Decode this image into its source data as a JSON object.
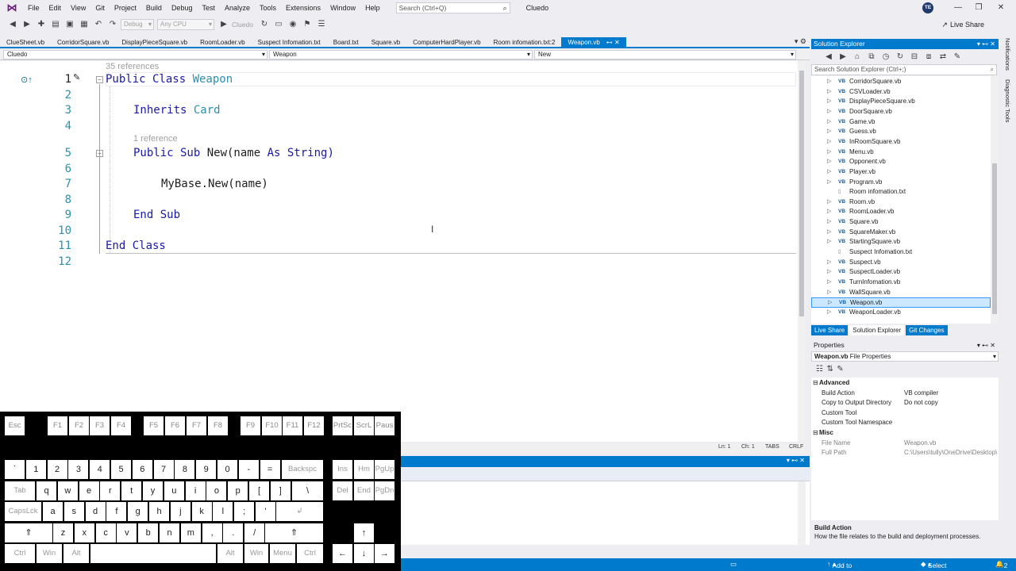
{
  "menu": {
    "items": [
      "File",
      "Edit",
      "View",
      "Git",
      "Project",
      "Build",
      "Debug",
      "Test",
      "Analyze",
      "Tools",
      "Extensions",
      "Window",
      "Help"
    ],
    "search_placeholder": "Search (Ctrl+Q)",
    "solution_name": "Cluedo",
    "avatar_initials": "TE"
  },
  "toolbar": {
    "config": "Debug",
    "platform": "Any CPU",
    "start_target": "Cluedo",
    "live_share": "Live Share"
  },
  "tabs": [
    {
      "label": "ClueSheet.vb",
      "active": false
    },
    {
      "label": "CorridorSquare.vb",
      "active": false
    },
    {
      "label": "DisplayPieceSquare.vb",
      "active": false
    },
    {
      "label": "RoomLoader.vb",
      "active": false
    },
    {
      "label": "Suspect Infomation.txt",
      "active": false
    },
    {
      "label": "Board.txt",
      "active": false
    },
    {
      "label": "Square.vb",
      "active": false
    },
    {
      "label": "ComputerHardPlayer.vb",
      "active": false
    },
    {
      "label": "Room infomation.txt:2",
      "active": false
    },
    {
      "label": "Weapon.vb",
      "active": true
    }
  ],
  "navbar": {
    "project": "Cluedo",
    "class": "Weapon",
    "member": "New"
  },
  "editor": {
    "codelens_class": "35 references",
    "codelens_sub": "1 reference",
    "lines": {
      "1": {
        "kw": "Public Class ",
        "ty": "Weapon"
      },
      "3": {
        "kw": "Inherits ",
        "ty": "Card"
      },
      "5": {
        "kw": "Public Sub ",
        "rest": "New(name ",
        "kw2": "As ",
        "rest2": "String)"
      },
      "7": {
        "text": "MyBase.New(name)"
      },
      "9": {
        "kw": "End Sub"
      },
      "11": {
        "kw": "End Class"
      }
    },
    "line_numbers": [
      "1",
      "2",
      "3",
      "4",
      "5",
      "6",
      "7",
      "8",
      "9",
      "10",
      "11",
      "12"
    ],
    "status": {
      "line": "Ln: 1",
      "col": "Ch: 1",
      "tabs": "TABS",
      "eol": "CRLF"
    }
  },
  "solution_explorer": {
    "title": "Solution Explorer",
    "search_placeholder": "Search Solution Explorer (Ctrl+;)",
    "items": [
      {
        "label": "CorridorSquare.vb",
        "type": "vb"
      },
      {
        "label": "CSVLoader.vb",
        "type": "vb"
      },
      {
        "label": "DisplayPieceSquare.vb",
        "type": "vb"
      },
      {
        "label": "DoorSquare.vb",
        "type": "vb"
      },
      {
        "label": "Game.vb",
        "type": "vb"
      },
      {
        "label": "Guess.vb",
        "type": "vb"
      },
      {
        "label": "InRoomSquare.vb",
        "type": "vb"
      },
      {
        "label": "Menu.vb",
        "type": "vb"
      },
      {
        "label": "Opponent.vb",
        "type": "vb"
      },
      {
        "label": "Player.vb",
        "type": "vb"
      },
      {
        "label": "Program.vb",
        "type": "vb"
      },
      {
        "label": "Room infomation.txt",
        "type": "txt"
      },
      {
        "label": "Room.vb",
        "type": "vb"
      },
      {
        "label": "RoomLoader.vb",
        "type": "vb"
      },
      {
        "label": "Square.vb",
        "type": "vb"
      },
      {
        "label": "SquareMaker.vb",
        "type": "vb"
      },
      {
        "label": "StartingSquare.vb",
        "type": "vb"
      },
      {
        "label": "Suspect Infomation.txt",
        "type": "txt"
      },
      {
        "label": "Suspect.vb",
        "type": "vb"
      },
      {
        "label": "SuspectLoader.vb",
        "type": "vb"
      },
      {
        "label": "TurnInfomation.vb",
        "type": "vb"
      },
      {
        "label": "WallSquare.vb",
        "type": "vb"
      },
      {
        "label": "Weapon.vb",
        "type": "vb",
        "selected": true
      },
      {
        "label": "WeaponLoader.vb",
        "type": "vb"
      }
    ],
    "tabs": [
      "Live Share",
      "Solution Explorer",
      "Git Changes"
    ],
    "vb_badge": "VB"
  },
  "properties": {
    "title": "Properties",
    "object_name": "Weapon.vb",
    "object_type": "File Properties",
    "rows": [
      {
        "kind": "cat",
        "name": "Advanced"
      },
      {
        "kind": "prop",
        "name": "Build Action",
        "value": "VB compiler"
      },
      {
        "kind": "prop",
        "name": "Copy to Output Directory",
        "value": "Do not copy"
      },
      {
        "kind": "prop",
        "name": "Custom Tool",
        "value": ""
      },
      {
        "kind": "prop",
        "name": "Custom Tool Namespace",
        "value": ""
      },
      {
        "kind": "cat",
        "name": "Misc"
      },
      {
        "kind": "prop",
        "name": "File Name",
        "value": "Weapon.vb",
        "disabled": true
      },
      {
        "kind": "prop",
        "name": "Full Path",
        "value": "C:\\Users\\tully\\OneDrive\\Desktop\\",
        "disabled": true
      }
    ],
    "desc_title": "Build Action",
    "desc_text": "How the file relates to the build and deployment processes."
  },
  "side_tabs": [
    "Notifications",
    "Diagnostic Tools"
  ],
  "statusbar": {
    "source_control": "Add to Source Control",
    "repository": "Select Repository",
    "notifications": "2"
  },
  "keyboard": {
    "row0": [
      "Esc",
      "F1",
      "F2",
      "F3",
      "F4",
      "F5",
      "F6",
      "F7",
      "F8",
      "F9",
      "F10",
      "F11",
      "F12",
      "PrtSc",
      "ScrL",
      "Paus"
    ],
    "row1": [
      "`",
      "1",
      "2",
      "3",
      "4",
      "5",
      "6",
      "7",
      "8",
      "9",
      "0",
      "-",
      "=",
      "Backspc",
      "Ins",
      "Hm",
      "PgUp"
    ],
    "row2": [
      "Tab",
      "q",
      "w",
      "e",
      "r",
      "t",
      "y",
      "u",
      "i",
      "o",
      "p",
      "[",
      "]",
      "\\",
      "Del",
      "End",
      "PgDn"
    ],
    "row3": [
      "CapsLck",
      "a",
      "s",
      "d",
      "f",
      "g",
      "h",
      "j",
      "k",
      "l",
      ";",
      "'",
      "↲"
    ],
    "row4": [
      "⇑",
      "z",
      "x",
      "c",
      "v",
      "b",
      "n",
      "m",
      ",",
      ".",
      "/",
      "⇑",
      "↑"
    ],
    "row5": [
      "Ctrl",
      "Win",
      "Alt",
      "Alt",
      "Win",
      "Menu",
      "Ctrl",
      "←",
      "↓",
      "→"
    ]
  }
}
